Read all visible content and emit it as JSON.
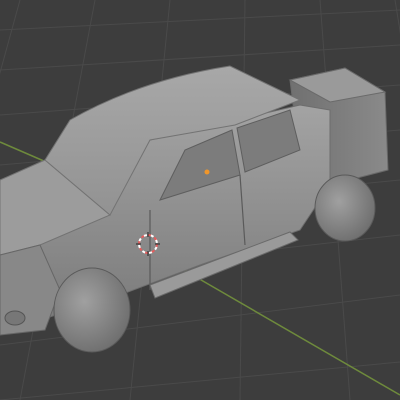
{
  "viewport": {
    "mode": "solid",
    "view": "perspective",
    "background_color": "#3d3d3d",
    "grid_color": "#4a4a4a",
    "axis_x_color": "#7a3f45",
    "axis_y_color": "#6e8a3c"
  },
  "scene": {
    "object": "pickup-truck",
    "object_type": "mesh",
    "shading": "matcap-gray",
    "body_color": "#8c8c8c",
    "origin_marker_color": "#f0962a",
    "cursor_3d_colors": [
      "#e35d5d",
      "#ffffff"
    ],
    "grid_visible": true,
    "floor_axes_visible": true
  }
}
